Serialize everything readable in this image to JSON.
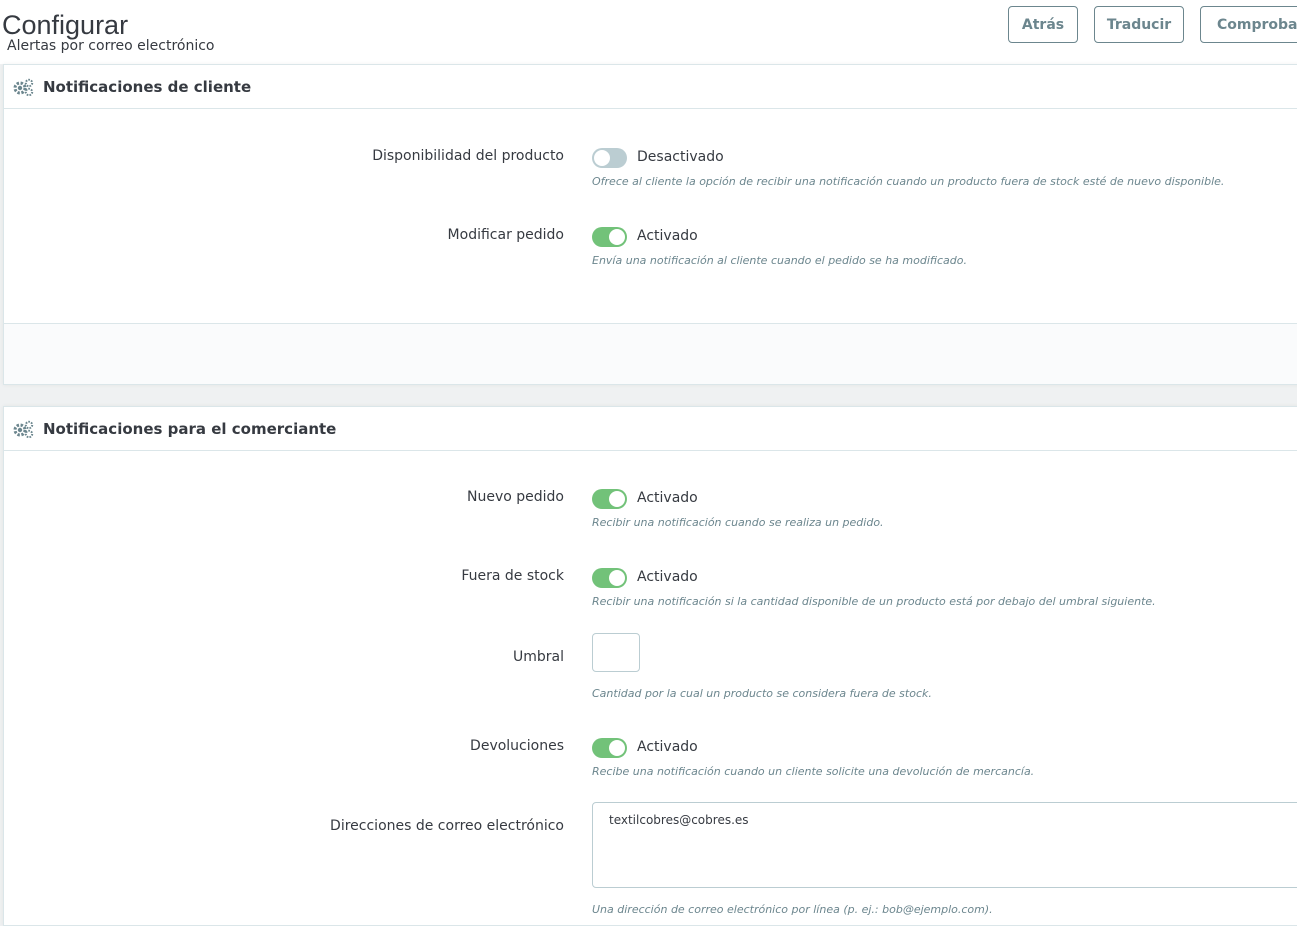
{
  "header": {
    "title": "Configurar",
    "subtitle": "Alertas por correo electrónico",
    "buttons": {
      "back": "Atrás",
      "translate": "Traducir",
      "check": "Comprobar"
    }
  },
  "customer_panel": {
    "title": "Notificaciones de cliente",
    "fields": [
      {
        "label": "Disponibilidad del producto",
        "state": "Desactivado",
        "enabled": false,
        "help": "Ofrece al cliente la opción de recibir una notificación cuando un producto fuera de stock esté de nuevo disponible."
      },
      {
        "label": "Modificar pedido",
        "state": "Activado",
        "enabled": true,
        "help": "Envía una notificación al cliente cuando el pedido se ha modificado."
      }
    ]
  },
  "merchant_panel": {
    "title": "Notificaciones para el comerciante",
    "new_order": {
      "label": "Nuevo pedido",
      "state": "Activado",
      "enabled": true,
      "help": "Recibir una notificación cuando se realiza un pedido."
    },
    "out_of_stock": {
      "label": "Fuera de stock",
      "state": "Activado",
      "enabled": true,
      "help": "Recibir una notificación si la cantidad disponible de un producto está por debajo del umbral siguiente."
    },
    "threshold": {
      "label": "Umbral",
      "value": "",
      "help": "Cantidad por la cual un producto se considera fuera de stock."
    },
    "returns": {
      "label": "Devoluciones",
      "state": "Activado",
      "enabled": true,
      "help": "Recibe una notificación cuando un cliente solicite una devolución de mercancía."
    },
    "emails": {
      "label": "Direcciones de correo electrónico",
      "value": "textilcobres@cobres.es",
      "help": "Una dirección de correo electrónico por línea (p. ej.: bob@ejemplo.com)."
    }
  },
  "colors": {
    "switch_on": "#72c279",
    "switch_off": "#bbcdd2",
    "text": "#363a41",
    "help_text": "#6c868e"
  }
}
